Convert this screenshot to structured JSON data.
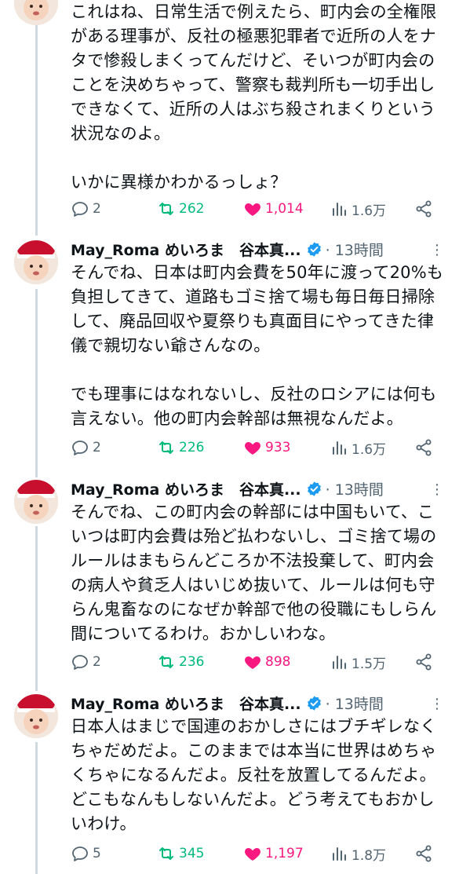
{
  "colors": {
    "retweet": "#00ba7c",
    "like": "#f91880",
    "muted": "#536471",
    "verified": "#1d9bf0"
  },
  "tweets": [
    {
      "text": "これはね、日常生活で例えたら、町内会の全権限がある理事が、反社の極悪犯罪者で近所の人をナタで惨殺しまくってんだけど、そいつが町内会のことを決めちゃって、警察も裁判所も一切手出しできなくて、近所の人はぶち殺されまくりという状況なのよ。\n\nいかに異様かわかるっしょ？",
      "replies": "2",
      "retweets": "262",
      "likes": "1,014",
      "views": "1.6万"
    },
    {
      "author": "May_Roma めいろま　谷本真...",
      "time": "· 13時間",
      "text": "そんでね、日本は町内会費を50年に渡って20%も負担してきて、道路もゴミ捨て場も毎日毎日掃除して、廃品回収や夏祭りも真面目にやってきた律儀で親切ない爺さんなの。\n\nでも理事にはなれないし、反社のロシアには何も言えない。他の町内会幹部は無視なんだよ。",
      "replies": "2",
      "retweets": "226",
      "likes": "933",
      "views": "1.6万"
    },
    {
      "author": "May_Roma めいろま　谷本真...",
      "time": "· 13時間",
      "text": "そんでね、この町内会の幹部には中国もいて、こいつは町内会費は殆ど払わないし、ゴミ捨て場のルールはまもらんどころか不法投棄して、町内会の病人や貧乏人はいじめ抜いて、ルールは何も守らん鬼畜なのになぜか幹部で他の役職にもしらん間についてるわけ。おかしいわな。",
      "replies": "2",
      "retweets": "236",
      "likes": "898",
      "views": "1.5万"
    },
    {
      "author": "May_Roma めいろま　谷本真...",
      "time": "· 13時間",
      "text": "日本人はまじで国連のおかしさにはブチギレなくちゃだめだよ。このままでは本当に世界はめちゃくちゃになるんだよ。反社を放置してるんだよ。どこもなんもしないんだよ。どう考えてもおかしいわけ。",
      "replies": "5",
      "retweets": "345",
      "likes": "1,197",
      "views": "1.8万"
    }
  ]
}
